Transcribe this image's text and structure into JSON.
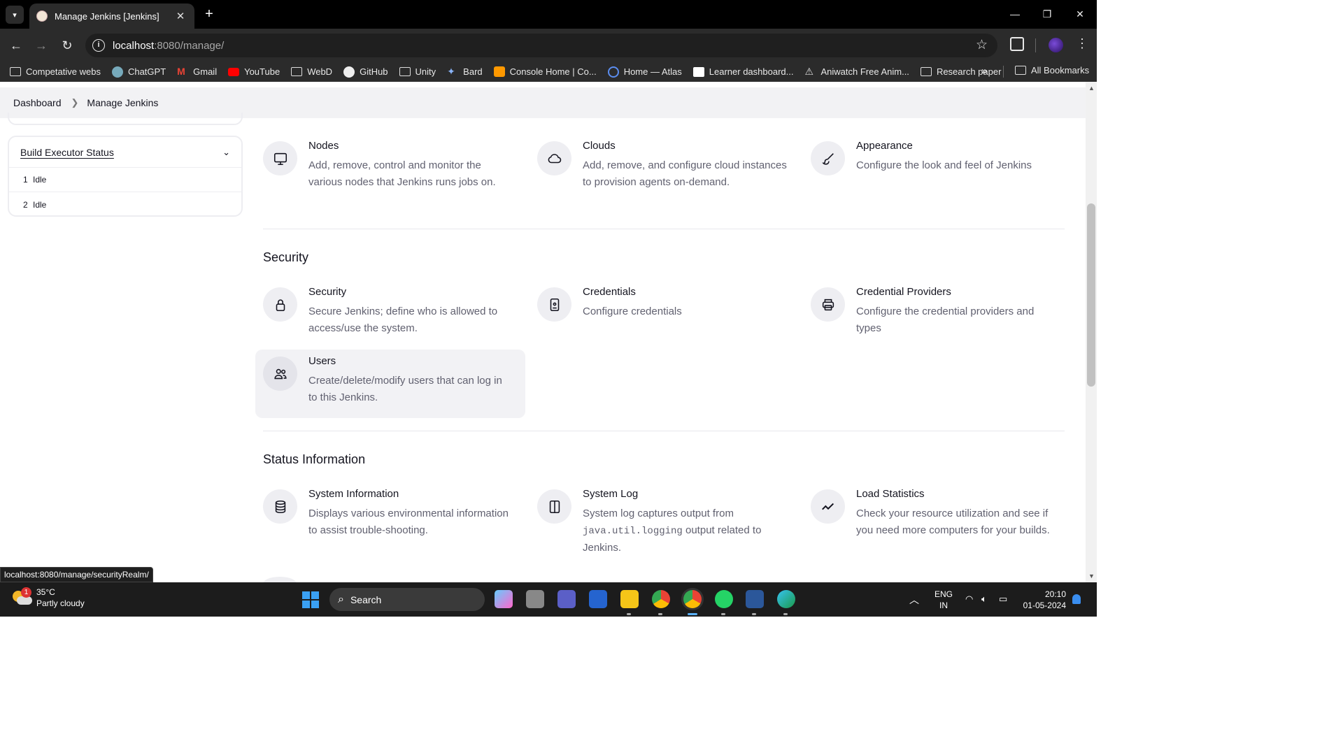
{
  "browser": {
    "tab_title": "Manage Jenkins [Jenkins]",
    "url_host": "localhost",
    "url_path": ":8080/manage/",
    "bookmarks": [
      {
        "label": "Competative webs",
        "icon": "folder-icon"
      },
      {
        "label": "ChatGPT",
        "icon": "chatgpt-icon"
      },
      {
        "label": "Gmail",
        "icon": "gmail-icon"
      },
      {
        "label": "YouTube",
        "icon": "youtube-icon"
      },
      {
        "label": "WebD",
        "icon": "folder-icon"
      },
      {
        "label": "GitHub",
        "icon": "github-icon"
      },
      {
        "label": "Unity",
        "icon": "folder-icon"
      },
      {
        "label": "Bard",
        "icon": "bard-icon"
      },
      {
        "label": "Console Home | Co...",
        "icon": "aws-icon"
      },
      {
        "label": "Home — Atlas",
        "icon": "atlas-icon"
      },
      {
        "label": "Learner dashboard...",
        "icon": "aws-icon"
      },
      {
        "label": "Aniwatch Free Anim...",
        "icon": "aniwatch-icon"
      },
      {
        "label": "Research paper",
        "icon": "folder-icon"
      }
    ],
    "all_bookmarks": "All Bookmarks",
    "status_url": "localhost:8080/manage/securityRealm/"
  },
  "breadcrumb": {
    "items": [
      "Dashboard",
      "Manage Jenkins"
    ]
  },
  "executors": {
    "title": "Build Executor Status",
    "rows": [
      {
        "num": "1",
        "status": "Idle"
      },
      {
        "num": "2",
        "status": "Idle"
      }
    ]
  },
  "system_config": {
    "items": [
      {
        "title": "Nodes",
        "desc": "Add, remove, control and monitor the various nodes that Jenkins runs jobs on.",
        "icon": "monitor-icon"
      },
      {
        "title": "Clouds",
        "desc": "Add, remove, and configure cloud instances to provision agents on-demand.",
        "icon": "cloud-icon"
      },
      {
        "title": "Appearance",
        "desc": "Configure the look and feel of Jenkins",
        "icon": "brush-icon"
      }
    ]
  },
  "security": {
    "heading": "Security",
    "items": [
      {
        "title": "Security",
        "desc": "Secure Jenkins; define who is allowed to access/use the system.",
        "icon": "lock-icon"
      },
      {
        "title": "Credentials",
        "desc": "Configure credentials",
        "icon": "id-card-icon"
      },
      {
        "title": "Credential Providers",
        "desc": "Configure the credential providers and types",
        "icon": "printer-icon"
      },
      {
        "title": "Users",
        "desc": "Create/delete/modify users that can log in to this Jenkins.",
        "icon": "users-icon"
      }
    ]
  },
  "status_info": {
    "heading": "Status Information",
    "items": [
      {
        "title": "System Information",
        "desc": "Displays various environmental information to assist trouble-shooting.",
        "icon": "database-icon"
      },
      {
        "title": "System Log",
        "desc_pre": "System log captures output from ",
        "desc_code": "java.util.logging",
        "desc_post": " output related to Jenkins.",
        "icon": "log-icon"
      },
      {
        "title": "Load Statistics",
        "desc": "Check your resource utilization and see if you need more computers for your builds.",
        "icon": "chart-line-icon"
      }
    ]
  },
  "taskbar": {
    "temp": "35°C",
    "weather": "Partly cloudy",
    "weather_badge": "1",
    "search": "Search",
    "lang_1": "ENG",
    "lang_2": "IN",
    "time": "20:10",
    "date": "01-05-2024"
  }
}
